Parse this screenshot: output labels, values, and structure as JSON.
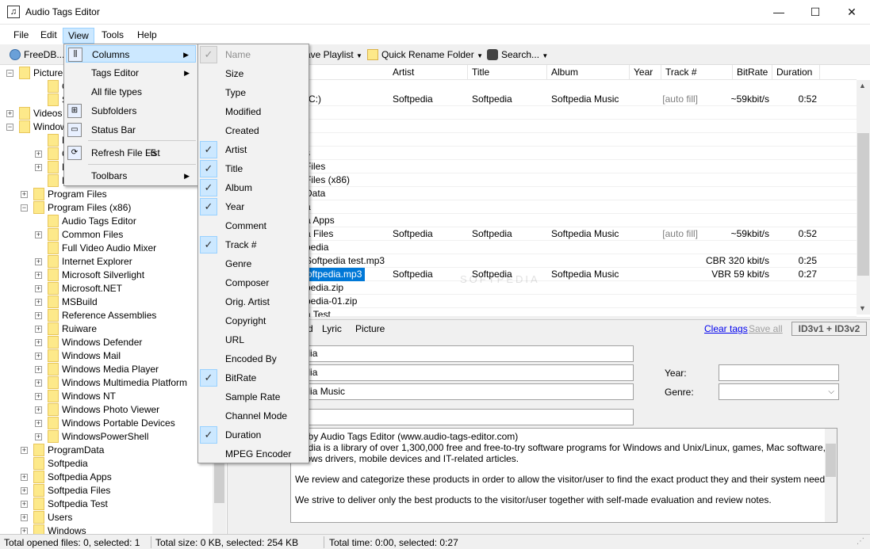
{
  "window": {
    "title": "Audio Tags Editor",
    "controls": [
      "—",
      "☐",
      "✕"
    ]
  },
  "menubar": [
    "File",
    "Edit",
    "View",
    "Tools",
    "Help"
  ],
  "toolbar": {
    "freedb": "FreeDB...",
    "save_playlist": "ave Playlist",
    "quick_rename": "Quick Rename Folder",
    "search": "Search..."
  },
  "tree": [
    {
      "label": "Picture",
      "exp": "−"
    },
    {
      "label": "Car",
      "exp": ""
    },
    {
      "label": "Sav",
      "exp": ""
    },
    {
      "label": "Videos",
      "exp": "+"
    },
    {
      "label": "Window",
      "exp": "−"
    },
    {
      "label": "BGi",
      "exp": ""
    },
    {
      "label": "CSD",
      "exp": "+"
    },
    {
      "label": "MU",
      "exp": "+"
    },
    {
      "label": "Per",
      "exp": ""
    },
    {
      "label": "Program Files",
      "exp": "+"
    },
    {
      "label": "Program Files (x86)",
      "exp": "−"
    },
    {
      "label": "Audio Tags Editor",
      "exp": ""
    },
    {
      "label": "Common Files",
      "exp": "+"
    },
    {
      "label": "Full Video Audio Mixer",
      "exp": ""
    },
    {
      "label": "Internet Explorer",
      "exp": "+"
    },
    {
      "label": "Microsoft Silverlight",
      "exp": "+"
    },
    {
      "label": "Microsoft.NET",
      "exp": "+"
    },
    {
      "label": "MSBuild",
      "exp": "+"
    },
    {
      "label": "Reference Assemblies",
      "exp": "+"
    },
    {
      "label": "Ruiware",
      "exp": "+"
    },
    {
      "label": "Windows Defender",
      "exp": "+"
    },
    {
      "label": "Windows Mail",
      "exp": "+"
    },
    {
      "label": "Windows Media Player",
      "exp": "+"
    },
    {
      "label": "Windows Multimedia Platform",
      "exp": "+"
    },
    {
      "label": "Windows NT",
      "exp": "+"
    },
    {
      "label": "Windows Photo Viewer",
      "exp": "+"
    },
    {
      "label": "Windows Portable Devices",
      "exp": "+"
    },
    {
      "label": "WindowsPowerShell",
      "exp": "+"
    },
    {
      "label": "ProgramData",
      "exp": "+"
    },
    {
      "label": "Softpedia",
      "exp": ""
    },
    {
      "label": "Softpedia Apps",
      "exp": "+"
    },
    {
      "label": "Softpedia Files",
      "exp": "+"
    },
    {
      "label": "Softpedia Test",
      "exp": "+"
    },
    {
      "label": "Users",
      "exp": "+"
    },
    {
      "label": "Windows",
      "exp": "+"
    }
  ],
  "list": {
    "columns": [
      "Artist",
      "Title",
      "Album",
      "Year",
      "Track #",
      "BitRate",
      "Duration"
    ],
    "rows": [
      {
        "name": "(C:)",
        "artist": "Softpedia",
        "title": "Softpedia",
        "album": "Softpedia Music",
        "year": "",
        "track": "[auto fill]",
        "bitrate": "~59kbit/s",
        "duration": "0:52"
      },
      {
        "name": "",
        "artist": "",
        "title": "",
        "album": "",
        "year": "",
        "track": "",
        "bitrate": "",
        "duration": ""
      },
      {
        "name": "",
        "artist": "",
        "title": "",
        "album": "",
        "year": "",
        "track": "",
        "bitrate": "",
        "duration": ""
      },
      {
        "name": "",
        "artist": "",
        "title": "",
        "album": "",
        "year": "",
        "track": "",
        "bitrate": "",
        "duration": ""
      },
      {
        "name": "s",
        "artist": "",
        "title": "",
        "album": "",
        "year": "",
        "track": "",
        "bitrate": "",
        "duration": ""
      },
      {
        "name": "Files",
        "artist": "",
        "title": "",
        "album": "",
        "year": "",
        "track": "",
        "bitrate": "",
        "duration": ""
      },
      {
        "name": "Files (x86)",
        "artist": "",
        "title": "",
        "album": "",
        "year": "",
        "track": "",
        "bitrate": "",
        "duration": ""
      },
      {
        "name": "Data",
        "artist": "",
        "title": "",
        "album": "",
        "year": "",
        "track": "",
        "bitrate": "",
        "duration": ""
      },
      {
        "name": "a",
        "artist": "",
        "title": "",
        "album": "",
        "year": "",
        "track": "",
        "bitrate": "",
        "duration": ""
      },
      {
        "name": "a Apps",
        "artist": "",
        "title": "",
        "album": "",
        "year": "",
        "track": "",
        "bitrate": "",
        "duration": ""
      },
      {
        "name": "a Files",
        "artist": "Softpedia",
        "title": "Softpedia",
        "album": "Softpedia Music",
        "year": "",
        "track": "[auto fill]",
        "bitrate": "~59kbit/s",
        "duration": "0:52"
      },
      {
        "name": "pedia",
        "artist": "",
        "title": "",
        "album": "",
        "year": "",
        "track": "",
        "bitrate": "",
        "duration": ""
      },
      {
        "name": "Softpedia test.mp3",
        "artist": "",
        "title": "",
        "album": "",
        "year": "",
        "track": "",
        "bitrate": "CBR 320 kbit/s",
        "duration": "0:25"
      },
      {
        "name": "oftpedia.mp3",
        "artist": "Softpedia",
        "title": "Softpedia",
        "album": "Softpedia Music",
        "year": "",
        "track": "",
        "bitrate": "VBR 59 kbit/s",
        "duration": "0:27"
      },
      {
        "name": "pedia.zip",
        "artist": "",
        "title": "",
        "album": "",
        "year": "",
        "track": "",
        "bitrate": "",
        "duration": ""
      },
      {
        "name": "pedia-01.zip",
        "artist": "",
        "title": "",
        "album": "",
        "year": "",
        "track": "",
        "bitrate": "",
        "duration": ""
      },
      {
        "name": "a Test",
        "artist": "",
        "title": "",
        "album": "",
        "year": "",
        "track": "",
        "bitrate": "",
        "duration": ""
      }
    ]
  },
  "tags": {
    "tabs": [
      "d",
      "Lyric",
      "Picture"
    ],
    "clear_tags": "Clear tags",
    "save_all": "Save all",
    "id3": "ID3v1 + ID3v2",
    "artist_value": "pedia",
    "title_value": "pedia",
    "album_value": "pedia Music",
    "year_label": "Year:",
    "genre_label": "Genre:",
    "comment": [
      "ed by Audio Tags Editor (www.audio-tags-editor.com)",
      "tpedia is a library of over 1,300,000 free and free-to-try software programs for Windows and Unix/Linux, games, Mac software,",
      "ndows drivers, mobile devices and IT-related articles.",
      "We review and categorize these products in order to allow the visitor/user to find the exact product they and their system needs.",
      "We strive to deliver only the best products to the visitor/user together with self-made evaluation and review notes."
    ]
  },
  "status": {
    "opened": "Total opened files: 0, selected: 1",
    "size": "Total size: 0 KB, selected: 254 KB",
    "time": "Total time: 0:00, selected: 0:27"
  },
  "view_menu": [
    {
      "label": "Columns",
      "arrow": "▶",
      "shortcut": ""
    },
    {
      "label": "Tags Editor",
      "arrow": "▶",
      "shortcut": ""
    },
    {
      "label": "All file types",
      "arrow": "",
      "shortcut": ""
    },
    {
      "label": "Subfolders",
      "arrow": "",
      "shortcut": ""
    },
    {
      "label": "Status Bar",
      "arrow": "",
      "shortcut": ""
    },
    {
      "label": "Refresh File List",
      "arrow": "",
      "shortcut": "F5"
    },
    {
      "label": "Toolbars",
      "arrow": "▶",
      "shortcut": ""
    }
  ],
  "columns_menu": [
    {
      "label": "Name",
      "checked": true,
      "disabled": true
    },
    {
      "label": "Size",
      "checked": false,
      "disabled": false
    },
    {
      "label": "Type",
      "checked": false,
      "disabled": false
    },
    {
      "label": "Modified",
      "checked": false,
      "disabled": false
    },
    {
      "label": "Created",
      "checked": false,
      "disabled": false
    },
    {
      "label": "Artist",
      "checked": true,
      "disabled": false
    },
    {
      "label": "Title",
      "checked": true,
      "disabled": false
    },
    {
      "label": "Album",
      "checked": true,
      "disabled": false
    },
    {
      "label": "Year",
      "checked": true,
      "disabled": false
    },
    {
      "label": "Comment",
      "checked": false,
      "disabled": false
    },
    {
      "label": "Track #",
      "checked": true,
      "disabled": false
    },
    {
      "label": "Genre",
      "checked": false,
      "disabled": false
    },
    {
      "label": "Composer",
      "checked": false,
      "disabled": false
    },
    {
      "label": "Orig. Artist",
      "checked": false,
      "disabled": false
    },
    {
      "label": "Copyright",
      "checked": false,
      "disabled": false
    },
    {
      "label": "URL",
      "checked": false,
      "disabled": false
    },
    {
      "label": "Encoded By",
      "checked": false,
      "disabled": false
    },
    {
      "label": "BitRate",
      "checked": true,
      "disabled": false
    },
    {
      "label": "Sample Rate",
      "checked": false,
      "disabled": false
    },
    {
      "label": "Channel Mode",
      "checked": false,
      "disabled": false
    },
    {
      "label": "Duration",
      "checked": true,
      "disabled": false
    },
    {
      "label": "MPEG Encoder",
      "checked": false,
      "disabled": false
    }
  ],
  "watermark": "SOFTPEDIA"
}
